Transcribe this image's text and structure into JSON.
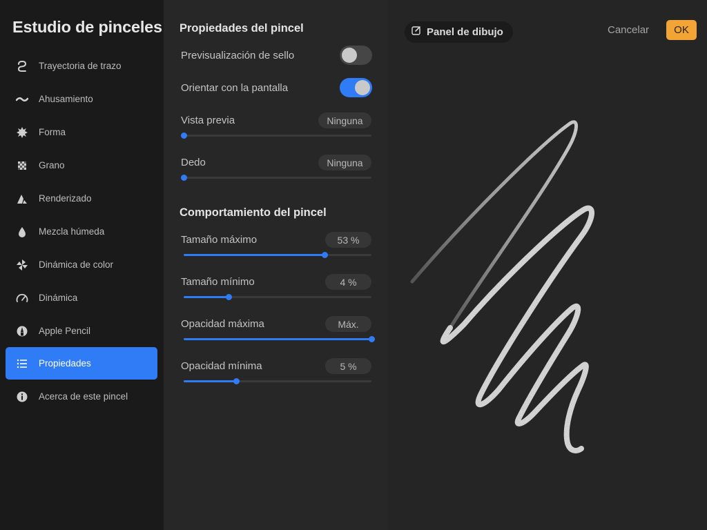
{
  "app_title": "Estudio de pinceles",
  "sidebar": {
    "items": [
      {
        "label": "Trayectoria de trazo",
        "icon": "stroke-path-icon",
        "active": false
      },
      {
        "label": "Ahusamiento",
        "icon": "taper-wave-icon",
        "active": false
      },
      {
        "label": "Forma",
        "icon": "shape-burst-icon",
        "active": false
      },
      {
        "label": "Grano",
        "icon": "grain-checker-icon",
        "active": false
      },
      {
        "label": "Renderizado",
        "icon": "rendering-icon",
        "active": false
      },
      {
        "label": "Mezcla húmeda",
        "icon": "droplet-icon",
        "active": false
      },
      {
        "label": "Dinámica de color",
        "icon": "color-pinwheel-icon",
        "active": false
      },
      {
        "label": "Dinámica",
        "icon": "gauge-icon",
        "active": false
      },
      {
        "label": "Apple Pencil",
        "icon": "pencil-tip-icon",
        "active": false
      },
      {
        "label": "Propiedades",
        "icon": "list-icon",
        "active": true
      },
      {
        "label": "Acerca de este pincel",
        "icon": "info-icon",
        "active": false
      }
    ]
  },
  "brush_properties": {
    "title": "Propiedades del pincel",
    "stamp_preview": {
      "label": "Previsualización de sello",
      "on": false
    },
    "orient_to_screen": {
      "label": "Orientar con la pantalla",
      "on": true
    },
    "preview": {
      "label": "Vista previa",
      "value": "Ninguna",
      "level": 0
    },
    "smudge": {
      "label": "Dedo",
      "value": "Ninguna",
      "level": 0
    }
  },
  "brush_behavior": {
    "title": "Comportamiento del pincel",
    "max_size": {
      "label": "Tamaño máximo",
      "value": "53 %",
      "level": 0.75
    },
    "min_size": {
      "label": "Tamaño mínimo",
      "value": "4 %",
      "level": 0.24
    },
    "max_opacity": {
      "label": "Opacidad máxima",
      "value": "Máx.",
      "level": 1.0
    },
    "min_opacity": {
      "label": "Opacidad mínima",
      "value": "5 %",
      "level": 0.28
    }
  },
  "drawing_area": {
    "drawing_pad_label": "Panel de dibujo",
    "cancel_label": "Cancelar",
    "ok_label": "OK"
  },
  "colors": {
    "accent": "#2f7cf6",
    "ok_button": "#f2a534",
    "sidebar_bg": "#1a1a1a",
    "panel_bg": "#272727",
    "canvas_bg": "#252525"
  }
}
